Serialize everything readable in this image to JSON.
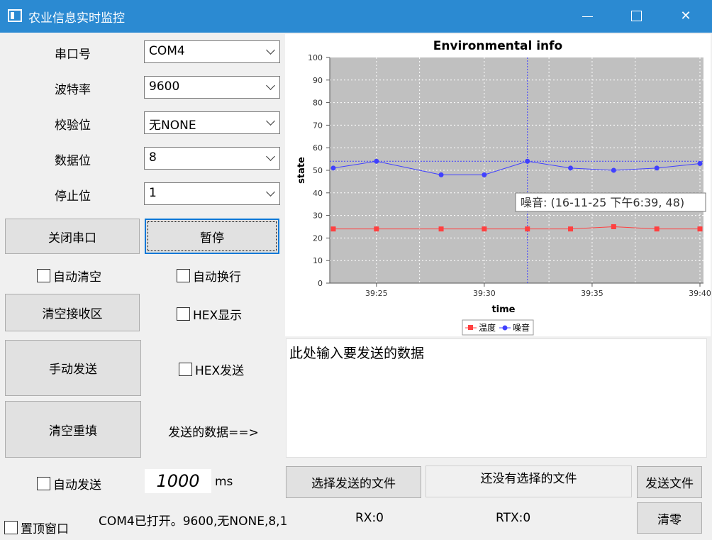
{
  "window": {
    "title": "农业信息实时监控",
    "minimize": "—",
    "maximize": "□",
    "close": "✕"
  },
  "serial": {
    "port_label": "串口号",
    "port_value": "COM4",
    "baud_label": "波特率",
    "baud_value": "9600",
    "parity_label": "校验位",
    "parity_value": "无NONE",
    "databits_label": "数据位",
    "databits_value": "8",
    "stopbits_label": "停止位",
    "stopbits_value": "1"
  },
  "buttons": {
    "close_port": "关闭串口",
    "pause": "暂停",
    "clear_receive": "清空接收区",
    "manual_send": "手动发送",
    "clear_refill": "清空重填",
    "choose_file": "选择发送的文件",
    "send_file": "发送文件",
    "reset": "清零"
  },
  "checkboxes": {
    "auto_clear": "自动清空",
    "auto_wrap": "自动换行",
    "hex_display": "HEX显示",
    "hex_send": "HEX发送",
    "auto_send": "自动发送",
    "topmost": "置顶窗口"
  },
  "send": {
    "arrow_label": "发送的数据==>",
    "input_placeholder": "此处输入要发送的数据",
    "interval_value": "1000",
    "interval_unit": "ms",
    "file_status": "还没有选择的文件"
  },
  "status": {
    "port_status": "COM4已打开。9600,无NONE,8,1",
    "rx": "RX:0",
    "rtx": "RTX:0"
  },
  "chart_data": {
    "type": "line",
    "title": "Environmental info",
    "xlabel": "time",
    "ylabel": "state",
    "ylim": [
      0,
      100
    ],
    "yticks": [
      "0",
      "10",
      "20",
      "30",
      "40",
      "50",
      "60",
      "70",
      "80",
      "90",
      "100"
    ],
    "xticks": [
      "39:25",
      "39:30",
      "39:35",
      "39:40"
    ],
    "x": [
      "39:23",
      "39:25",
      "39:28",
      "39:30",
      "39:32",
      "39:34",
      "39:36",
      "39:38",
      "39:40"
    ],
    "series": [
      {
        "name": "温度",
        "color": "#ff4040",
        "marker": "square",
        "values": [
          24,
          24,
          24,
          24,
          24,
          24,
          25,
          24,
          24
        ]
      },
      {
        "name": "噪音",
        "color": "#4040ff",
        "marker": "circle",
        "values": [
          51,
          54,
          48,
          48,
          54,
          51,
          50,
          51,
          53
        ]
      }
    ],
    "crosshair": {
      "x": "39:32",
      "y": 54
    },
    "tooltip": "噪音: (16-11-25 下午6:39, 48)",
    "grid": true,
    "legend": "bottom"
  }
}
